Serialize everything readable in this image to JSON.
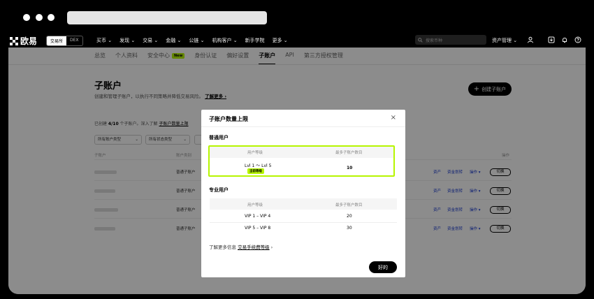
{
  "app": {
    "logo_text": "欧易",
    "mode_tabs": [
      "交易所",
      "DEX"
    ],
    "menu": [
      "买币 ⌄",
      "发现 ⌄",
      "交易 ⌄",
      "金融 ⌄",
      "公链 ⌄",
      "机构客户 ⌄",
      "新手学院",
      "更多 ⌄"
    ],
    "search_placeholder": "搜索币种",
    "assets_label": "资产管理 ⌄"
  },
  "tabs": [
    "总览",
    "个人资料",
    "安全中心",
    "身份认证",
    "偏好设置",
    "子账户",
    "API",
    "第三方授权管理"
  ],
  "tab_badge": "New",
  "page": {
    "title": "子账户",
    "desc": "创建和管理子账户，以执行不同策略并降低交易风险。",
    "learn_more": "了解更多 ›",
    "create_btn": "创建子账户",
    "quota_prefix": "已创建 ",
    "quota_count": "4/10",
    "quota_mid": " 个子账户。深入了解 ",
    "quota_link": "子账户数量上限",
    "filter_type": "所有账户类型",
    "filter_status": "所有状态类型",
    "col_name": "子账户",
    "col_type": "账户类别",
    "col_ops": "操作",
    "row_type": "普通子账户",
    "row_links": [
      "资产",
      "资金划转",
      "操作 ▾"
    ],
    "row_switch": "切换"
  },
  "modal": {
    "title": "子账户数量上限",
    "close": "×",
    "normal_section": "普通用户",
    "pro_section": "专业用户",
    "col_level": "用户等级",
    "col_max": "最多子账户数目",
    "normal_rows": [
      {
        "level": "Lvl 1 ～ Lvl 5",
        "badge": "当前等级",
        "max": "10"
      }
    ],
    "pro_rows": [
      {
        "level": "VIP 1 – VIP 4",
        "max": "20"
      },
      {
        "level": "VIP 5 – VIP 8",
        "max": "30"
      }
    ],
    "foot_prefix": "了解更多信息 ",
    "foot_link": "交易手续费等级",
    "foot_arrow": " ›",
    "ok": "好的"
  }
}
